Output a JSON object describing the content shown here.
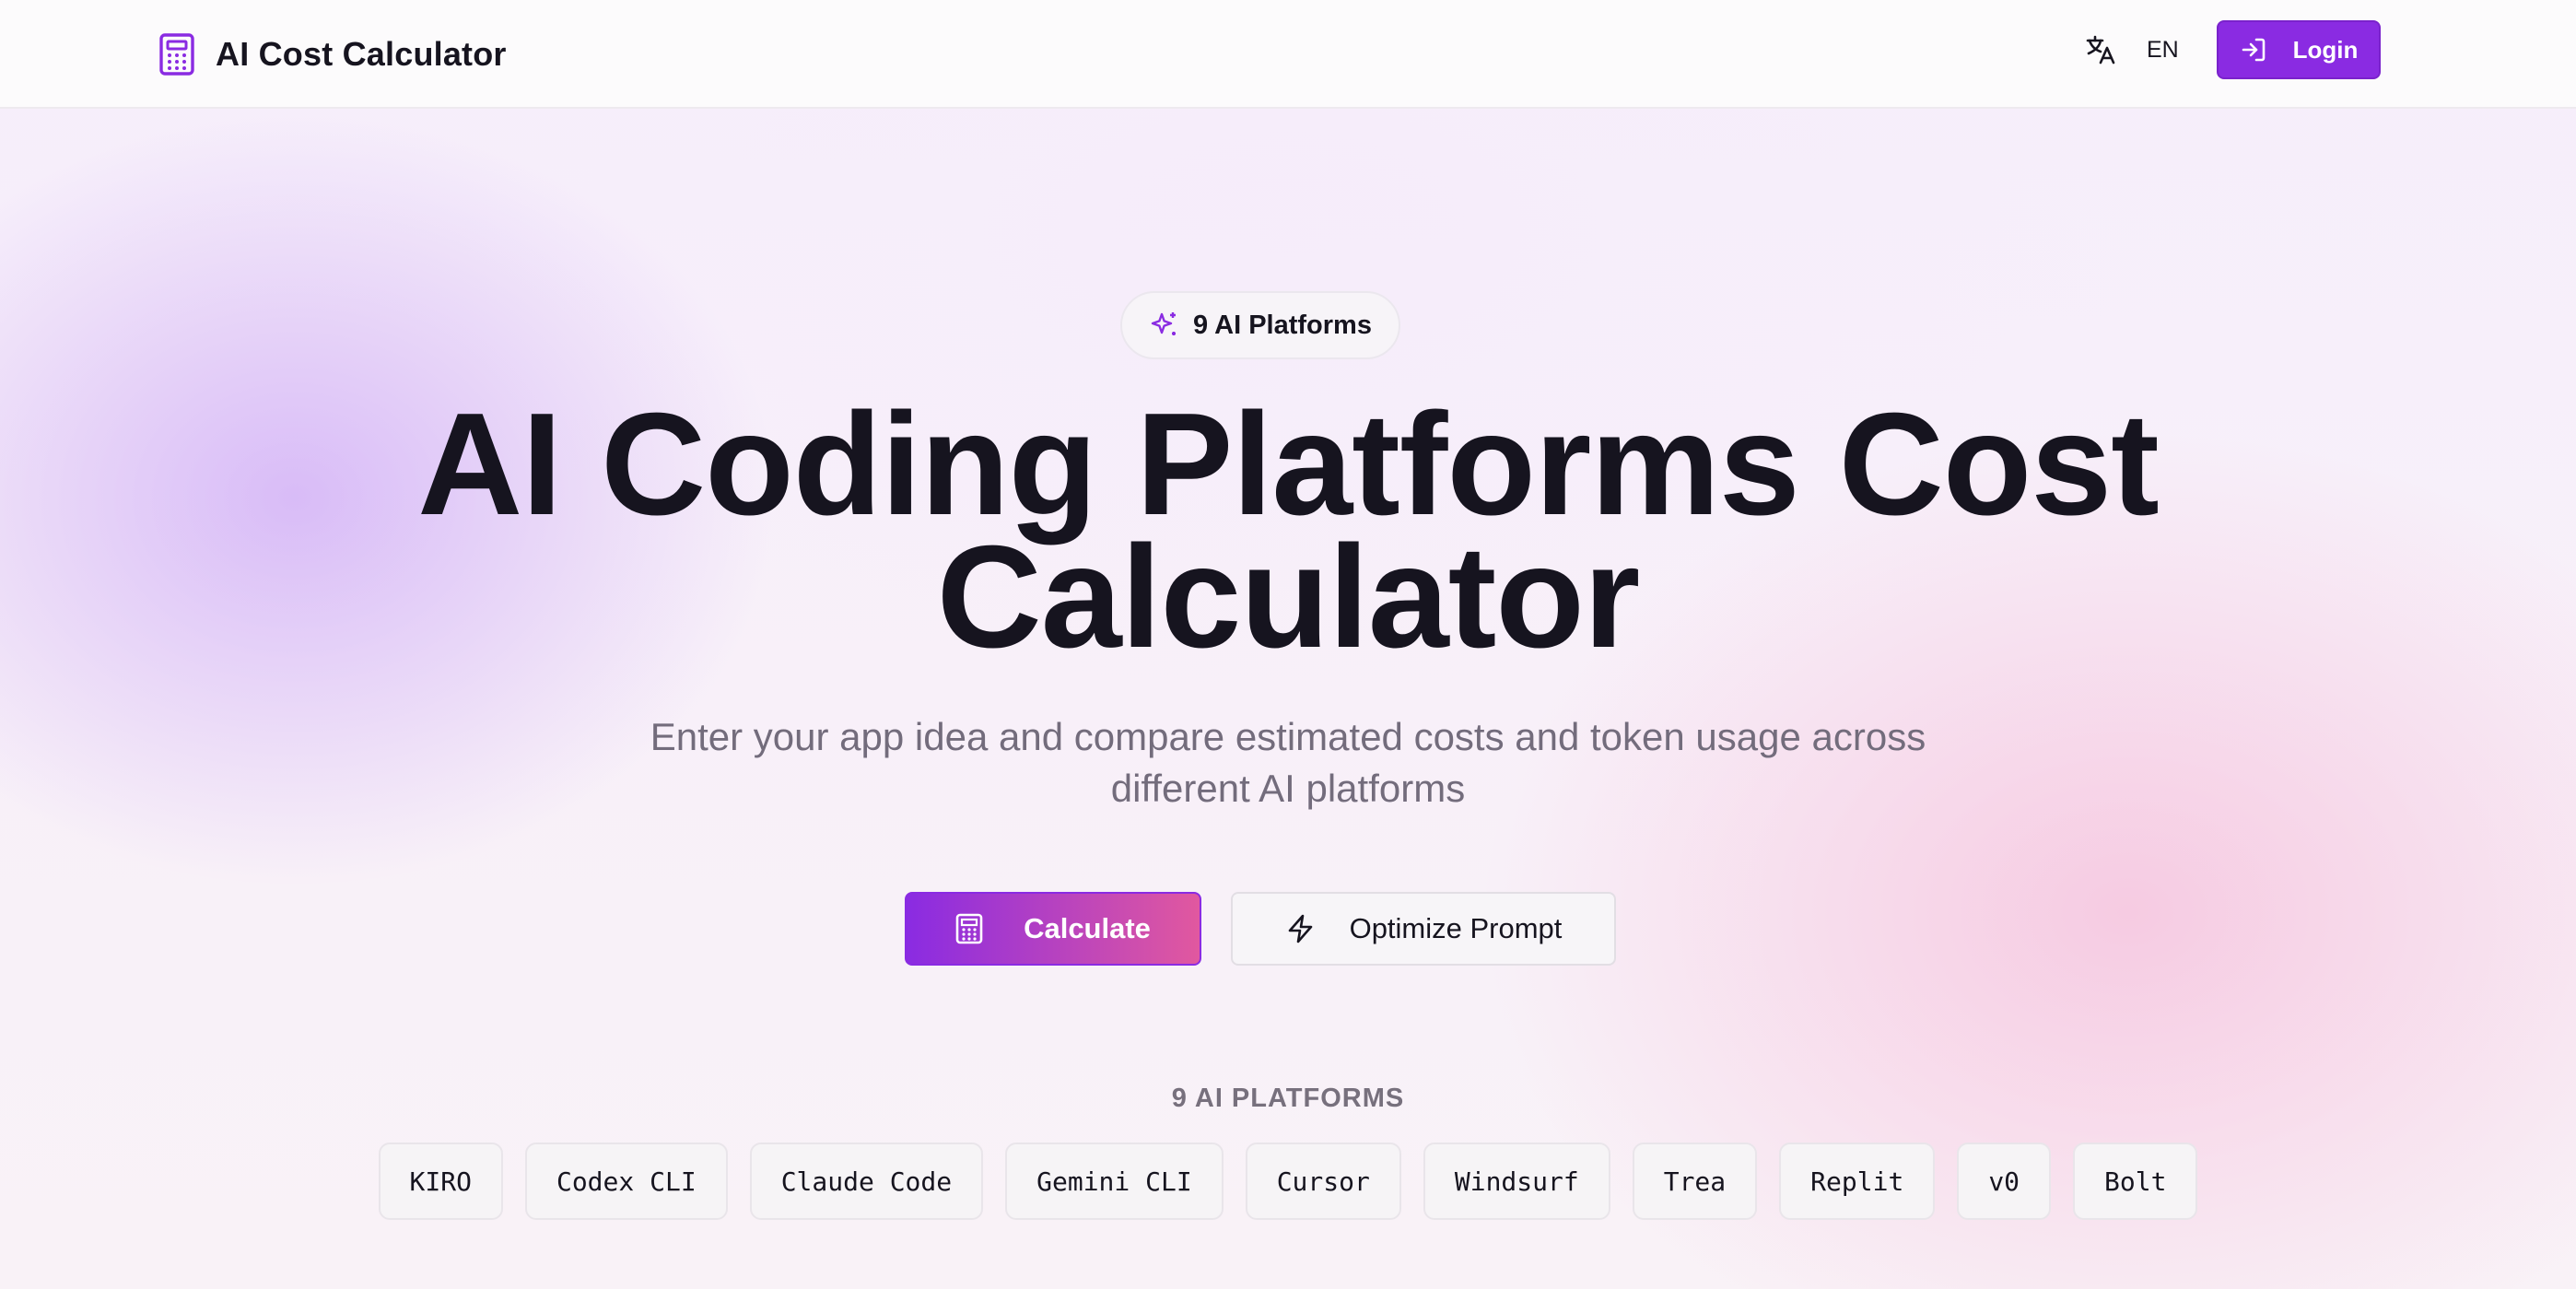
{
  "header": {
    "brand_title": "AI Cost Calculator",
    "brand_icon": "calculator-icon",
    "language_icon": "translate-icon",
    "language_label": "EN",
    "login_label": "Login",
    "login_icon": "login-icon",
    "accent_color": "#8a2be2"
  },
  "hero": {
    "badge_icon": "sparkles-icon",
    "badge_text": "9 AI Platforms",
    "title_line1": "AI Coding Platforms Cost",
    "title_line2": "Calculator",
    "subtitle_line1": "Enter your app idea and compare estimated costs and token usage across",
    "subtitle_line2": "different AI platforms",
    "calculate_label": "Calculate",
    "calculate_icon": "calculator-icon",
    "optimize_label": "Optimize Prompt",
    "optimize_icon": "lightning-icon",
    "gradient_start": "#8a2be2",
    "gradient_end": "#e1589f"
  },
  "platforms": {
    "section_label": "9 AI PLATFORMS",
    "items": [
      "KIRO",
      "Codex CLI",
      "Claude Code",
      "Gemini CLI",
      "Cursor",
      "Windsurf",
      "Trea",
      "Replit",
      "v0",
      "Bolt"
    ]
  }
}
